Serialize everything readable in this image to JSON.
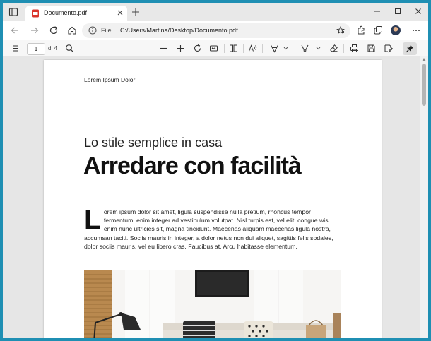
{
  "browser": {
    "tab": {
      "title": "Documento.pdf"
    },
    "address": {
      "scheme_label": "File",
      "url": "C:/Users/Martina/Desktop/Documento.pdf"
    }
  },
  "pdf_toolbar": {
    "current_page": "1",
    "page_count_label": "di 4"
  },
  "document": {
    "header": "Lorem Ipsum Dolor",
    "subtitle": "Lo stile semplice in casa",
    "title": "Arredare con facilità",
    "drop_cap": "L",
    "body": "orem ipsum dolor sit amet, ligula suspendisse nulla pretium, rhoncus tempor fermentum, enim integer ad vestibulum volutpat. Nisl turpis est, vel elit, congue wisi enim nunc ultricies sit, magna tincidunt. Maecenas aliquam maecenas ligula nostra, accumsan taciti. Sociis mauris in integer, a dolor netus non dui aliquet, sagittis felis sodales, dolor sociis mauris, vel eu libero cras. Faucibus at. Arcu habitasse elementum."
  },
  "colors": {
    "desktop": "#1f8fb3",
    "pdf_icon": "#d9342b",
    "accent": "#0067c0"
  }
}
